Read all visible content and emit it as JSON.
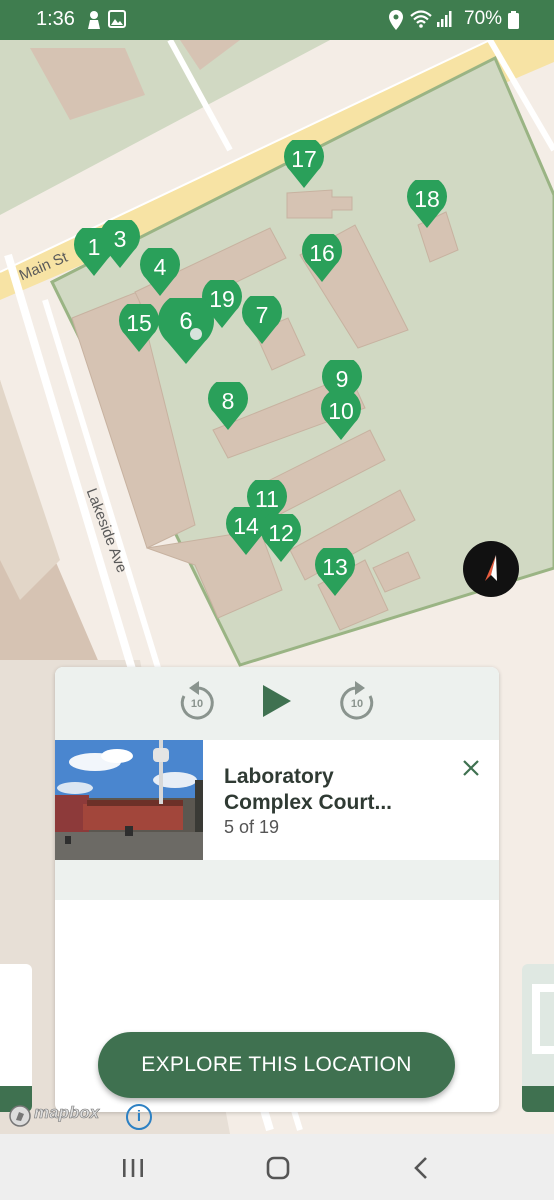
{
  "status_bar": {
    "time": "1:36",
    "battery": "70%"
  },
  "map": {
    "streets": {
      "main": "Main St",
      "lakeside": "Lakeside Ave"
    },
    "markers": [
      "1",
      "3",
      "4",
      "6",
      "7",
      "8",
      "9",
      "10",
      "11",
      "12",
      "13",
      "14",
      "15",
      "16",
      "17",
      "18",
      "19"
    ]
  },
  "player": {
    "rewind_label": "10",
    "forward_label": "10"
  },
  "stop": {
    "title_line1": "Laboratory",
    "title_line2": "Complex Court...",
    "count": "5 of 19"
  },
  "actions": {
    "explore": "EXPLORE THIS LOCATION"
  },
  "attribution": {
    "logo": "mapbox",
    "info": "i"
  },
  "colors": {
    "brand_green": "#3f7d4f",
    "pin_green": "#2aa05a",
    "button_green": "#3f7150"
  }
}
